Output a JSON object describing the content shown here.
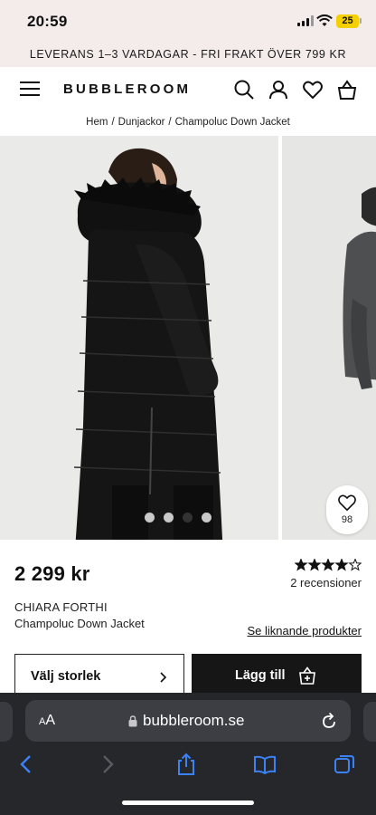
{
  "status_bar": {
    "time": "20:59",
    "battery": "25"
  },
  "promo": {
    "text": "LEVERANS 1–3 VARDAGAR - FRI FRAKT ÖVER 799 KR"
  },
  "header": {
    "logo": "BUBBLEROOM",
    "icons": [
      "menu-icon",
      "search-icon",
      "account-icon",
      "heart-icon",
      "bag-icon"
    ]
  },
  "breadcrumb": {
    "items": [
      "Hem",
      "Dunjackor",
      "Champoluc Down Jacket"
    ],
    "separator": "/"
  },
  "gallery": {
    "dots": 4,
    "active_dot": 2,
    "favorite_count": "98"
  },
  "product": {
    "price": "2 299 kr",
    "rating": 4,
    "rating_max": 5,
    "reviews": "2 recensioner",
    "brand": "CHIARA FORTHI",
    "name": "Champoluc Down Jacket",
    "similar_link": "Se liknande produkter"
  },
  "actions": {
    "size_label": "Välj storlek",
    "cart_label": "Lägg till"
  },
  "browser": {
    "text_size": "AA",
    "url": "bubbleroom.se"
  },
  "colors": {
    "promo_bg": "#f3ecea",
    "button_dark": "#161616",
    "safari_bg": "#26272b",
    "link_blue": "#3b82f6"
  }
}
